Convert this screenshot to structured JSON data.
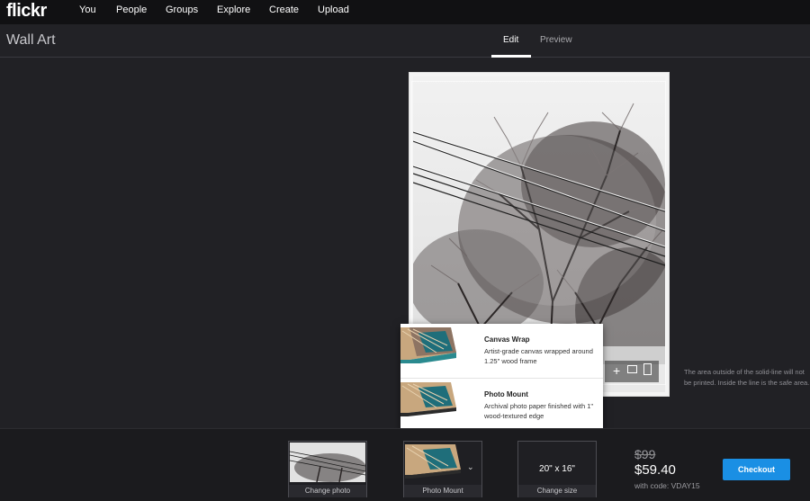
{
  "nav": {
    "logo": "flickr",
    "items": [
      "You",
      "People",
      "Groups",
      "Explore",
      "Create",
      "Upload"
    ]
  },
  "header": {
    "title": "Wall Art",
    "tabs": [
      {
        "label": "Edit",
        "active": true
      },
      {
        "label": "Preview",
        "active": false
      }
    ]
  },
  "editor": {
    "tools": [
      "plus-icon",
      "landscape-icon",
      "portrait-icon"
    ],
    "hint": "The area outside of the solid-line will not be printed. Inside the line is the safe area."
  },
  "popover": {
    "options": [
      {
        "title": "Canvas Wrap",
        "desc": "Artist-grade canvas wrapped around 1.25\" wood frame"
      },
      {
        "title": "Photo Mount",
        "desc": "Archival photo paper finished with 1\" wood-textured edge"
      }
    ]
  },
  "bottom": {
    "change_photo_label": "Change photo",
    "product_label": "Photo Mount",
    "size_value": "20\" x 16\"",
    "size_label": "Change size",
    "price_old": "$99",
    "price_new": "$59.40",
    "price_code": "with code: VDAY15",
    "checkout_label": "Checkout"
  },
  "colors": {
    "accent": "#1a8fe4",
    "topbar": "#111113",
    "background": "#222226"
  }
}
